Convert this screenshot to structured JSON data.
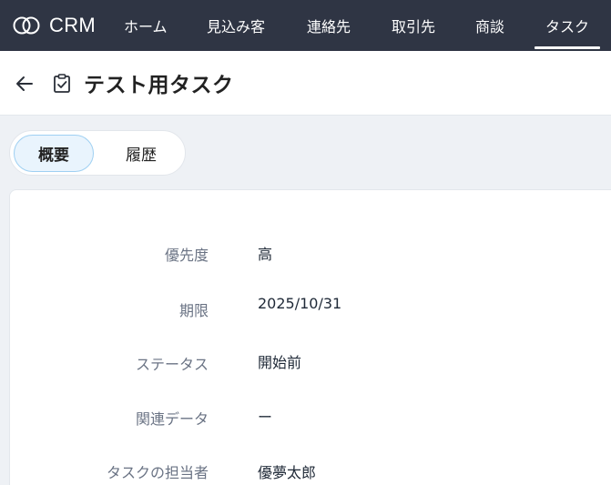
{
  "app": {
    "brand": "CRM",
    "nav": [
      {
        "label": "ホーム"
      },
      {
        "label": "見込み客"
      },
      {
        "label": "連絡先"
      },
      {
        "label": "取引先"
      },
      {
        "label": "商談"
      },
      {
        "label": "タスク",
        "active": true
      }
    ]
  },
  "header": {
    "title": "テスト用タスク"
  },
  "tabs": [
    {
      "label": "概要",
      "active": true
    },
    {
      "label": "履歴",
      "active": false
    }
  ],
  "details": [
    {
      "label": "優先度",
      "value": "高"
    },
    {
      "label": "期限",
      "value": "2025/10/31"
    },
    {
      "label": "ステータス",
      "value": "開始前"
    },
    {
      "label": "関連データ",
      "value": "ー"
    },
    {
      "label": "タスクの担当者",
      "value": "優夢太郎"
    }
  ]
}
